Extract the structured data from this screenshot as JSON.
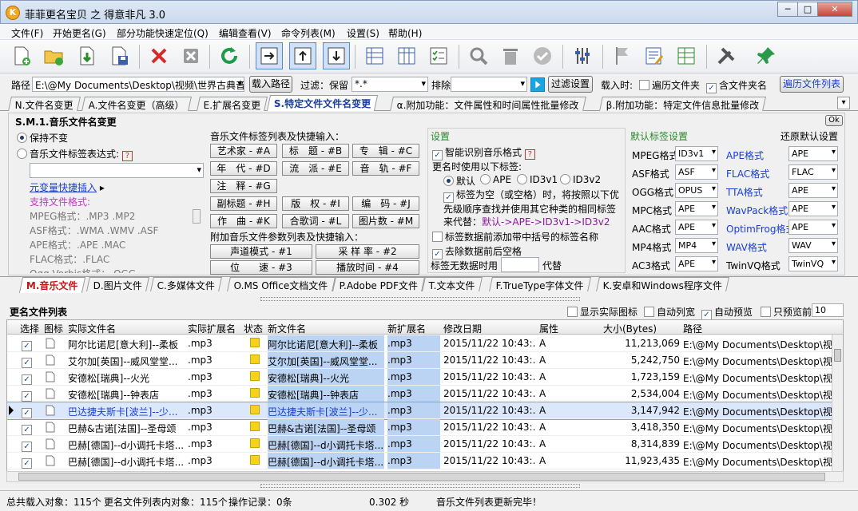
{
  "window": {
    "title": "菲菲更名宝贝 之 得意非凡 3.0",
    "app_icon": "K"
  },
  "menu": [
    "文件(F)",
    "开始更名(G)",
    "部分功能快速定位(Q)",
    "编辑查看(V)",
    "命令列表(M)",
    "设置(S)",
    "帮助(H)"
  ],
  "pathbar": {
    "path_label": "路径",
    "path_value": "E:\\@My Documents\\Desktop\\视频\\世界古典音乐\\",
    "load_btn": "载入路径",
    "filter_label": "过滤：保留",
    "filter_value": "*.*",
    "exclude_label": "排除",
    "filter_settings_btn": "过滤设置",
    "load_time_label": "载入时:",
    "recurse_label": "遍历文件夹",
    "include_folder_label": "含文件夹名",
    "recurse_list_btn": "遍历文件列表"
  },
  "tabs_top": [
    "N.文件名变更",
    "A.文件名变更（高级）",
    "E.扩展名变更",
    "S.特定文件文件名变更",
    "α.附加功能：文件属性和时间属性批量修改",
    "β.附加功能：特定文件信息批量修改"
  ],
  "panel": {
    "title": "S.M.1.音乐文件名变更",
    "ok": "Ok",
    "keep": "保持不变",
    "tag_expr": "音乐文件标签表达式:",
    "meta_quick": "元变量快捷插入",
    "support_title": "支持文件格式:",
    "support": [
      "MPEG格式：.MP3 .MP2",
      "ASF格式：.WMA .WMV .ASF",
      "APE格式：.APE .MAC",
      "FLAC格式：.FLAC",
      "Ogg Vorbis格式：.OGG"
    ],
    "tags_title": "音乐文件标签列表及快捷输入：",
    "tags": [
      [
        "艺术家 - #A",
        "标　题 - #B",
        "专　辑 - #C"
      ],
      [
        "年　代 - #D",
        "流　派 - #E",
        "音　轨 - #F"
      ],
      [
        "注　释 - #G"
      ],
      [
        "副标题 - #H",
        "版　权 - #I",
        "编　码 - #J"
      ],
      [
        "作　曲 - #K",
        "合歌词 - #L",
        "图片数 - #M"
      ]
    ],
    "param_title": "附加音乐文件参数列表及快捷输入：",
    "params": [
      "声道模式 - #1",
      "采 样 率 - #2",
      "位　　速 - #3",
      "播放时间 - #4"
    ],
    "settings_title": "设置",
    "smart": "智能识别音乐格式",
    "use_tag": "更名时使用以下标签:",
    "opt_default": "默认",
    "opt_ape": "APE",
    "opt_id3v1": "ID3v1",
    "opt_id3v2": "ID3v2",
    "empty_tag": "标签为空（或空格）时，将按照以下优先级顺序查找并使用其它种类的相同标签来代替：",
    "default_order": "默认->APE->ID3v1->ID3v2",
    "bracket": "标签数据前添加带中括号的标签名称",
    "trim": "去除数据前后空格",
    "nodata_prefix": "标签无数据时用",
    "nodata_suffix": "代替",
    "defaults_title": "默认标签设置",
    "restore": "还原默认设置",
    "formats_left": [
      [
        "MPEG格式",
        "ID3v1"
      ],
      [
        "ASF格式",
        "ASF"
      ],
      [
        "OGG格式",
        "OPUS"
      ],
      [
        "MPC格式",
        "APE"
      ],
      [
        "AAC格式",
        "APE"
      ],
      [
        "MP4格式",
        "MP4"
      ],
      [
        "AC3格式",
        "APE"
      ]
    ],
    "formats_right": [
      [
        "APE格式",
        "APE"
      ],
      [
        "FLAC格式",
        "FLAC"
      ],
      [
        "TTA格式",
        "APE"
      ],
      [
        "WavPack格式",
        "APE"
      ],
      [
        "OptimFrog格式",
        "APE"
      ],
      [
        "WAV格式",
        "WAV"
      ],
      [
        "TwinVQ格式",
        "TwinVQ"
      ]
    ]
  },
  "tabs_bottom": [
    "M.音乐文件",
    "D.图片文件",
    "C.多媒体文件",
    "O.MS Office文档文件",
    "P.Adobe PDF文件",
    "T.文本文件",
    "F.TrueType字体文件",
    "K.安卓和Windows程序文件"
  ],
  "list": {
    "title": "更名文件列表",
    "show_icon": "显示实际图标",
    "auto_width": "自动列宽",
    "auto_preview": "自动预览",
    "preview_first": "只预览前",
    "preview_count": "10",
    "columns": [
      "选择",
      "图标",
      "实际文件名",
      "实际扩展名",
      "状态",
      "新文件名",
      "新扩展名",
      "修改日期",
      "属性",
      "大小(Bytes)",
      "路径"
    ],
    "rows": [
      [
        "阿尔比诺尼[意大利]--柔板",
        ".mp3",
        "阿尔比诺尼[意大利]--柔板",
        ".mp3",
        "2015/11/22 10:43:...",
        "A",
        "11,213,069",
        "E:\\@My Documents\\Desktop\\视..."
      ],
      [
        "艾尔加[英国]--威风堂堂...",
        ".mp3",
        "艾尔加[英国]--威风堂堂...",
        ".mp3",
        "2015/11/22 10:43:...",
        "A",
        "5,242,750",
        "E:\\@My Documents\\Desktop\\视..."
      ],
      [
        "安德松[瑞典]--火光",
        ".mp3",
        "安德松[瑞典]--火光",
        ".mp3",
        "2015/11/22 10:43:...",
        "A",
        "1,723,159",
        "E:\\@My Documents\\Desktop\\视..."
      ],
      [
        "安德松[瑞典]--钟表店",
        ".mp3",
        "安德松[瑞典]--钟表店",
        ".mp3",
        "2015/11/22 10:43:...",
        "A",
        "2,534,004",
        "E:\\@My Documents\\Desktop\\视..."
      ],
      [
        "巴达捷夫斯卡[波兰]--少...",
        ".mp3",
        "巴达捷夫斯卡[波兰]--少...",
        ".mp3",
        "2015/11/22 10:43:...",
        "A",
        "3,147,942",
        "E:\\@My Documents\\Desktop\\视..."
      ],
      [
        "巴赫&古诺[法国]--圣母颂",
        ".mp3",
        "巴赫&古诺[法国]--圣母颂",
        ".mp3",
        "2015/11/22 10:43:...",
        "A",
        "3,418,350",
        "E:\\@My Documents\\Desktop\\视..."
      ],
      [
        "巴赫[德国]--d小调托卡塔...",
        ".mp3",
        "巴赫[德国]--d小调托卡塔...",
        ".mp3",
        "2015/11/22 10:43:...",
        "A",
        "8,314,839",
        "E:\\@My Documents\\Desktop\\视..."
      ],
      [
        "巴赫[德国]--d小调托卡塔...",
        ".mp3",
        "巴赫[德国]--d小调托卡塔...",
        ".mp3",
        "2015/11/22 10:43:...",
        "A",
        "11,923,435",
        "E:\\@My Documents\\Desktop\\视..."
      ]
    ]
  },
  "status": {
    "total": "总共载入对象：115个",
    "list": "更名文件列表内对象：115个",
    "ops": "操作记录：0条",
    "time": "0.302 秒",
    "msg": "音乐文件列表更新完毕！"
  }
}
